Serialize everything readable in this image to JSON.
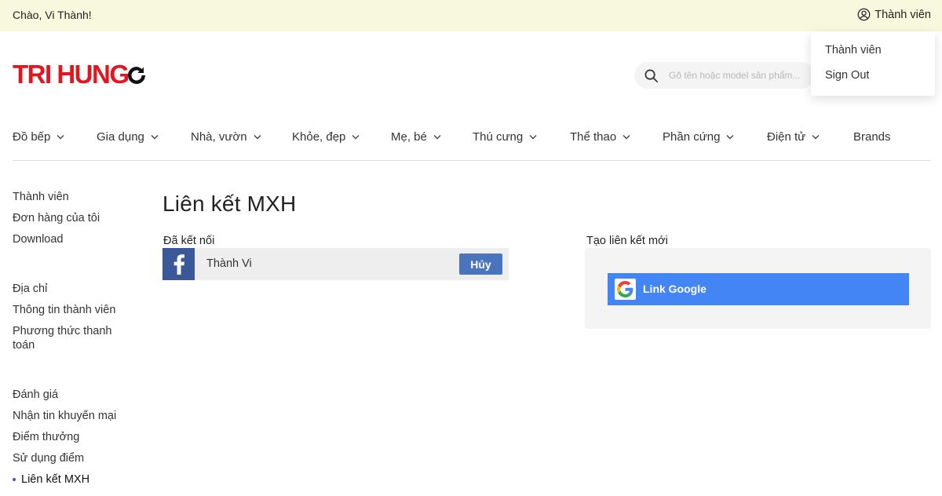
{
  "topbar": {
    "greeting": "Chào, Vi Thành!",
    "member_link": "Thành viên"
  },
  "dropdown": {
    "items": [
      "Thành viên",
      "Sign Out"
    ]
  },
  "brand": {
    "logo_text": "TRI HUNG",
    "logo_color": "#e3161f"
  },
  "search": {
    "placeholder": "Gõ tên hoặc model sản phẩm...",
    "value": ""
  },
  "nav": {
    "items": [
      "Đồ bếp",
      "Gia dụng",
      "Nhà, vườn",
      "Khỏe, đẹp",
      "Mẹ, bé",
      "Thú cưng",
      "Thể thao",
      "Phần cứng",
      "Điện tử",
      "Brands"
    ]
  },
  "sidebar": {
    "items": [
      "Thành viên",
      "Đơn hàng của tôi",
      "Download",
      "Địa chỉ",
      "Thông tin thành viên",
      "Phương thức thanh toán",
      "Đánh giá",
      "Nhận tin khuyến mại",
      "Điểm thưởng",
      "Sử dụng điểm",
      "Liên kết MXH"
    ],
    "active_index": 10
  },
  "main": {
    "title": "Liên kết MXH",
    "connected_label": "Đã kết nối",
    "connected": {
      "provider_icon": "facebook-icon",
      "name": "Thành Vi",
      "cancel_label": "Hủy"
    },
    "new_link_label": "Tạo liên kết mới",
    "google_button_label": "Link Google"
  },
  "colors": {
    "topbar_bg": "#f7f8dd",
    "facebook": "#3b5998",
    "cancel_button": "#4a74bb",
    "google_button": "#4385f5",
    "active_dot": "#6b3fd6"
  }
}
